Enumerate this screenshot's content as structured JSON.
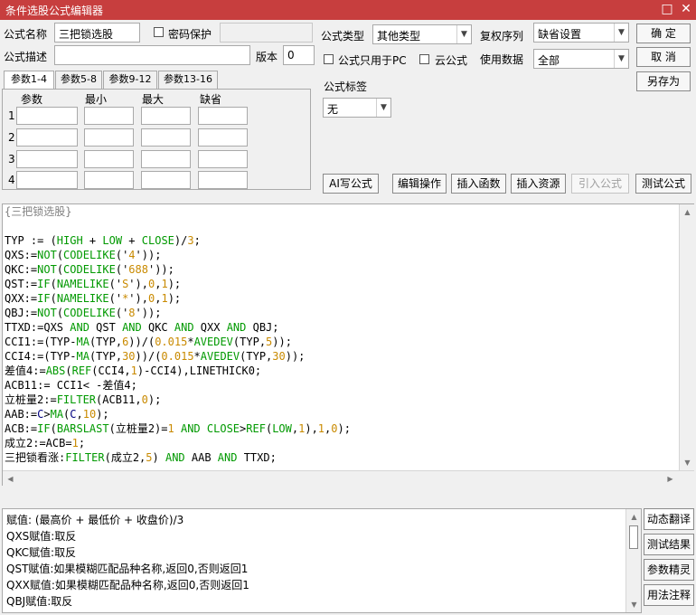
{
  "window": {
    "title": "条件选股公式编辑器",
    "restore_glyph": "□",
    "close_glyph": "✕"
  },
  "header": {
    "name_label": "公式名称",
    "name_value": "三把锁选股",
    "password_label": "密码保护",
    "password_value": "",
    "desc_label": "公式描述",
    "desc_value": "",
    "version_label": "版本",
    "version_value": "0",
    "type_label": "公式类型",
    "type_value": "其他类型",
    "rights_label": "复权序列",
    "rights_value": "缺省设置",
    "pc_only_label": "公式只用于PC",
    "cloud_label": "云公式",
    "data_label": "使用数据",
    "data_value": "全部",
    "tag_label": "公式标签",
    "tag_value": "无"
  },
  "buttons": {
    "confirm": "确 定",
    "cancel": "取 消",
    "save_as": "另存为",
    "ai_write": "AI写公式",
    "edit_ops": "编辑操作",
    "insert_func": "插入函数",
    "insert_res": "插入资源",
    "import_formula": "引入公式",
    "test_formula": "测试公式"
  },
  "tabs": [
    "参数1-4",
    "参数5-8",
    "参数9-12",
    "参数13-16"
  ],
  "param_headers": [
    "参数",
    "最小",
    "最大",
    "缺省"
  ],
  "param_rows": [
    "1",
    "2",
    "3",
    "4"
  ],
  "code_lines": [
    [
      {
        "t": "{三把锁选股}",
        "c": "#808080"
      }
    ],
    [],
    [
      {
        "t": "TYP := ("
      },
      {
        "t": "HIGH",
        "c": "k"
      },
      {
        "t": " + "
      },
      {
        "t": "LOW",
        "c": "k"
      },
      {
        "t": " + "
      },
      {
        "t": "CLOSE",
        "c": "k"
      },
      {
        "t": ")/"
      },
      {
        "t": "3",
        "c": "n"
      },
      {
        "t": ";"
      }
    ],
    [
      {
        "t": "QXS:="
      },
      {
        "t": "NOT",
        "c": "k"
      },
      {
        "t": "("
      },
      {
        "t": "CODELIKE",
        "c": "k"
      },
      {
        "t": "('"
      },
      {
        "t": "4",
        "c": "n"
      },
      {
        "t": "'));"
      }
    ],
    [
      {
        "t": "QKC:="
      },
      {
        "t": "NOT",
        "c": "k"
      },
      {
        "t": "("
      },
      {
        "t": "CODELIKE",
        "c": "k"
      },
      {
        "t": "('"
      },
      {
        "t": "688",
        "c": "n"
      },
      {
        "t": "'));"
      }
    ],
    [
      {
        "t": "QST:="
      },
      {
        "t": "IF",
        "c": "k"
      },
      {
        "t": "("
      },
      {
        "t": "NAMELIKE",
        "c": "k"
      },
      {
        "t": "('"
      },
      {
        "t": "S",
        "c": "n"
      },
      {
        "t": "'),"
      },
      {
        "t": "0",
        "c": "n"
      },
      {
        "t": ","
      },
      {
        "t": "1",
        "c": "n"
      },
      {
        "t": ");"
      }
    ],
    [
      {
        "t": "QXX:="
      },
      {
        "t": "IF",
        "c": "k"
      },
      {
        "t": "("
      },
      {
        "t": "NAMELIKE",
        "c": "k"
      },
      {
        "t": "('"
      },
      {
        "t": "*",
        "c": "n"
      },
      {
        "t": "'),"
      },
      {
        "t": "0",
        "c": "n"
      },
      {
        "t": ","
      },
      {
        "t": "1",
        "c": "n"
      },
      {
        "t": ");"
      }
    ],
    [
      {
        "t": "QBJ:="
      },
      {
        "t": "NOT",
        "c": "k"
      },
      {
        "t": "("
      },
      {
        "t": "CODELIKE",
        "c": "k"
      },
      {
        "t": "('"
      },
      {
        "t": "8",
        "c": "n"
      },
      {
        "t": "'));"
      }
    ],
    [
      {
        "t": "TTXD:=QXS "
      },
      {
        "t": "AND",
        "c": "k"
      },
      {
        "t": " QST "
      },
      {
        "t": "AND",
        "c": "k"
      },
      {
        "t": " QKC "
      },
      {
        "t": "AND",
        "c": "k"
      },
      {
        "t": " QXX "
      },
      {
        "t": "AND",
        "c": "k"
      },
      {
        "t": " QBJ;"
      }
    ],
    [
      {
        "t": "CCI1:=(TYP-"
      },
      {
        "t": "MA",
        "c": "k"
      },
      {
        "t": "(TYP,"
      },
      {
        "t": "6",
        "c": "n"
      },
      {
        "t": "))/("
      },
      {
        "t": "0.015",
        "c": "n"
      },
      {
        "t": "*"
      },
      {
        "t": "AVEDEV",
        "c": "k"
      },
      {
        "t": "(TYP,"
      },
      {
        "t": "5",
        "c": "n"
      },
      {
        "t": "));"
      }
    ],
    [
      {
        "t": "CCI4:=(TYP-"
      },
      {
        "t": "MA",
        "c": "k"
      },
      {
        "t": "(TYP,"
      },
      {
        "t": "30",
        "c": "n"
      },
      {
        "t": "))/("
      },
      {
        "t": "0.015",
        "c": "n"
      },
      {
        "t": "*"
      },
      {
        "t": "AVEDEV",
        "c": "k"
      },
      {
        "t": "(TYP,"
      },
      {
        "t": "30",
        "c": "n"
      },
      {
        "t": "));"
      }
    ],
    [
      {
        "t": "差值4:="
      },
      {
        "t": "ABS",
        "c": "k"
      },
      {
        "t": "("
      },
      {
        "t": "REF",
        "c": "k"
      },
      {
        "t": "(CCI4,"
      },
      {
        "t": "1",
        "c": "n"
      },
      {
        "t": ")-CCI4),LINETHICK0;"
      }
    ],
    [
      {
        "t": "ACB11:= CCI1< -差值4;"
      }
    ],
    [
      {
        "t": "立桩量2:="
      },
      {
        "t": "FILTER",
        "c": "k"
      },
      {
        "t": "(ACB11,"
      },
      {
        "t": "0",
        "c": "n"
      },
      {
        "t": ");"
      }
    ],
    [
      {
        "t": "AAB:="
      },
      {
        "t": "C",
        "c": "f"
      },
      {
        "t": ">"
      },
      {
        "t": "MA",
        "c": "k"
      },
      {
        "t": "("
      },
      {
        "t": "C",
        "c": "f"
      },
      {
        "t": ","
      },
      {
        "t": "10",
        "c": "n"
      },
      {
        "t": ");"
      }
    ],
    [
      {
        "t": "ACB:="
      },
      {
        "t": "IF",
        "c": "k"
      },
      {
        "t": "("
      },
      {
        "t": "BARSLAST",
        "c": "k"
      },
      {
        "t": "(立桩量2)="
      },
      {
        "t": "1",
        "c": "n"
      },
      {
        "t": " "
      },
      {
        "t": "AND",
        "c": "k"
      },
      {
        "t": " "
      },
      {
        "t": "CLOSE",
        "c": "k"
      },
      {
        "t": ">"
      },
      {
        "t": "REF",
        "c": "k"
      },
      {
        "t": "("
      },
      {
        "t": "LOW",
        "c": "k"
      },
      {
        "t": ","
      },
      {
        "t": "1",
        "c": "n"
      },
      {
        "t": "),"
      },
      {
        "t": "1",
        "c": "n"
      },
      {
        "t": ","
      },
      {
        "t": "0",
        "c": "n"
      },
      {
        "t": ");"
      }
    ],
    [
      {
        "t": "成立2:=ACB="
      },
      {
        "t": "1",
        "c": "n"
      },
      {
        "t": ";"
      }
    ],
    [
      {
        "t": "三把锁看涨:"
      },
      {
        "t": "FILTER",
        "c": "k"
      },
      {
        "t": "(成立2,"
      },
      {
        "t": "5",
        "c": "n"
      },
      {
        "t": ") "
      },
      {
        "t": "AND",
        "c": "k"
      },
      {
        "t": " AAB "
      },
      {
        "t": "AND",
        "c": "k"
      },
      {
        "t": " TTXD;"
      }
    ]
  ],
  "description_lines": [
    "赋值: (最高价 + 最低价 + 收盘价)/3",
    "QXS赋值:取反",
    "QKC赋值:取反",
    "QST赋值:如果模糊匹配品种名称,返回0,否则返回1",
    "QXX赋值:如果模糊匹配品种名称,返回0,否则返回1",
    "QBJ赋值:取反"
  ],
  "side_buttons": [
    "动态翻译",
    "测试结果",
    "参数精灵",
    "用法注释"
  ],
  "colors": {
    "titlebar": "#c73e3e",
    "keyword": "#009900",
    "number": "#c98a00",
    "field_c": "#000080",
    "comment": "#808080"
  }
}
